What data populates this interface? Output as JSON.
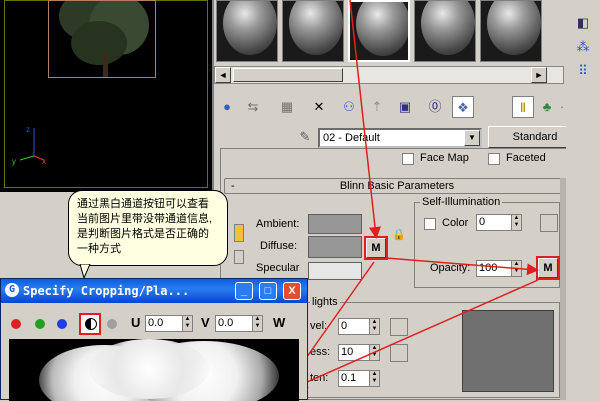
{
  "material_editor": {
    "material_name": "02 - Default",
    "material_type": "Standard",
    "face_map_label": "Face Map",
    "faceted_label": "Faceted",
    "blinn_rollout": "Blinn Basic Parameters",
    "ambient_label": "Ambient:",
    "diffuse_label": "Diffuse:",
    "specular_label": "Specular",
    "self_illum_group": "Self-Illumination",
    "color_label": "Color",
    "color_value": "0",
    "opacity_label": "Opacity:",
    "opacity_value": "100",
    "map_button": "M",
    "highlights_label": "lights",
    "specular_level_label": "vel:",
    "specular_level_value": "0",
    "glossiness_label": "ess:",
    "glossiness_value": "10",
    "soften_label": "ten:",
    "soften_value": "0.1"
  },
  "tooltip": {
    "text": "通过黑白通道按钮可以查看当前图片里带没带通道信息,是判断图片格式是否正确的一种方式"
  },
  "dialog": {
    "title": "Specify Cropping/Pla...",
    "minimize": "_",
    "maximize": "□",
    "close": "X",
    "u_label": "U",
    "u_value": "0.0",
    "v_label": "V",
    "v_value": "0.0",
    "w_label": "W"
  },
  "colors": {
    "annotation_red": "#e02020",
    "title_blue": "#0a5ee0",
    "tooltip_bg": "#ffffe1"
  }
}
